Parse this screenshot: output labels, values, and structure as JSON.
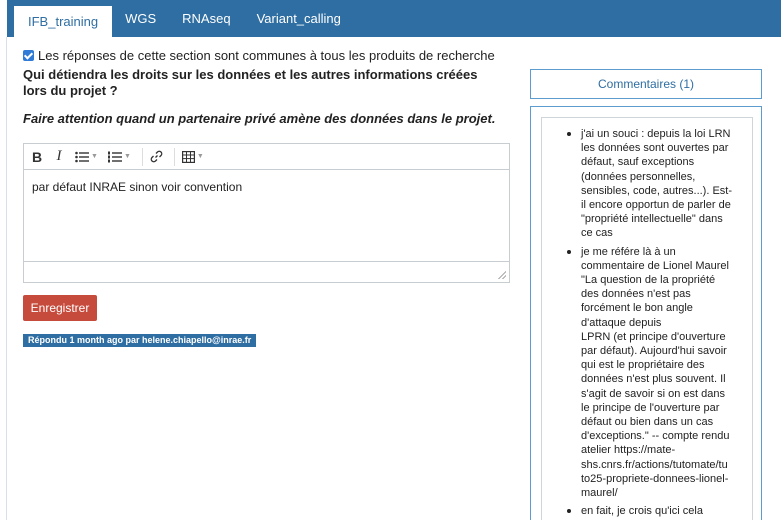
{
  "tabs": [
    {
      "label": "IFB_training",
      "active": true
    },
    {
      "label": "WGS",
      "active": false
    },
    {
      "label": "RNAseq",
      "active": false
    },
    {
      "label": "Variant_calling",
      "active": false
    }
  ],
  "common_checkbox": {
    "checked": true,
    "label": "Les réponses de cette section sont communes à tous les produits de recherche"
  },
  "question": {
    "text": "Qui détiendra les droits sur les données et les autres informations créées lors du projet ?",
    "guidance": "Faire attention quand un partenaire privé amène des données dans le projet."
  },
  "editor": {
    "content": "par défaut INRAE sinon voir convention",
    "toolbar": [
      "bold-icon",
      "italic-icon",
      "bullet-list-icon",
      "numbered-list-icon",
      "link-icon",
      "table-icon"
    ]
  },
  "save_label": "Enregistrer",
  "answered_label": "Répondu 1 month ago par helene.chiapello@inrae.fr",
  "comments": {
    "header": "Commentaires (1)",
    "items": [
      {
        "text": "j'ai un souci : depuis la loi LRN\nles données sont ouvertes par\ndéfaut, sauf exceptions\n(données personnelles,\nsensibles, code, autres...). Est-\nil encore opportun de parler de\n\"propriété intellectuelle\" dans\nce cas"
      },
      {
        "text": "je me référe là à un\ncommentaire de Lionel Maurel\n\"La question de la propriété\ndes données n'est pas\nforcément le bon angle\nd'attaque depuis\nLPRN (et principe d'ouverture\npar défaut). Aujourd'hui savoir\nqui est le propriétaire des\ndonnées n'est plus souvent. Il\ns'agit de savoir si on est dans\nle principe de l'ouverture par\ndéfaut ou bien dans un cas\nd'exceptions.\" -- compte rendu\natelier https://mate-\nshs.cnrs.fr/actions/tutomate/tu\nto25-propriete-donnees-lionel-\nmaurel/"
      },
      {
        "text": "en fait, je crois qu'ici cela\ndemandera à terme une re-"
      }
    ]
  },
  "colors": {
    "primary": "#2f6ea2",
    "save_button": "#c64b3c",
    "checkbox": "#2f7bd6"
  }
}
